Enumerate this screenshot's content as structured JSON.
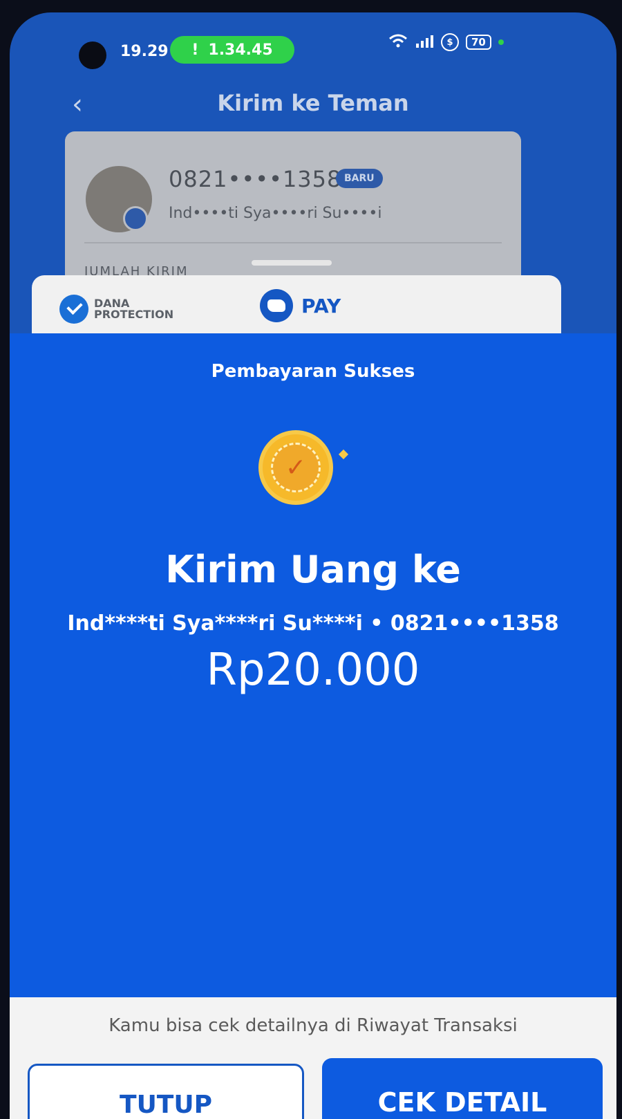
{
  "status_bar": {
    "time": "19.29",
    "timer_icon": "!",
    "timer": "1.34.45",
    "battery": "70",
    "icons": [
      "wifi-icon",
      "signal-icon",
      "vpn-icon",
      "battery-icon"
    ]
  },
  "header": {
    "back_icon": "‹",
    "title": "Kirim ke Teman"
  },
  "recipient_card": {
    "phone": "0821••••1358",
    "badge": "BARU",
    "name": "Ind••••ti Sya••••ri Su••••i",
    "section_label": "JUMLAH KIRIM"
  },
  "sheet": {
    "protection_line1": "DANA",
    "protection_line2": "PROTECTION",
    "pay_label": "PAY",
    "status": "Pembayaran Sukses",
    "success_icon": "✓",
    "send_title": "Kirim Uang ke",
    "send_recipient": "Ind****ti Sya****ri Su****i • 0821••••1358",
    "amount": "Rp20.000",
    "hint": "Kamu bisa cek detailnya di Riwayat Transaksi",
    "close_button": "TUTUP",
    "detail_button": "CEK DETAIL"
  },
  "colors": {
    "primary_blue": "#0d5be0",
    "success_green": "#2fd14a",
    "coin_gold": "#f6b92a"
  }
}
